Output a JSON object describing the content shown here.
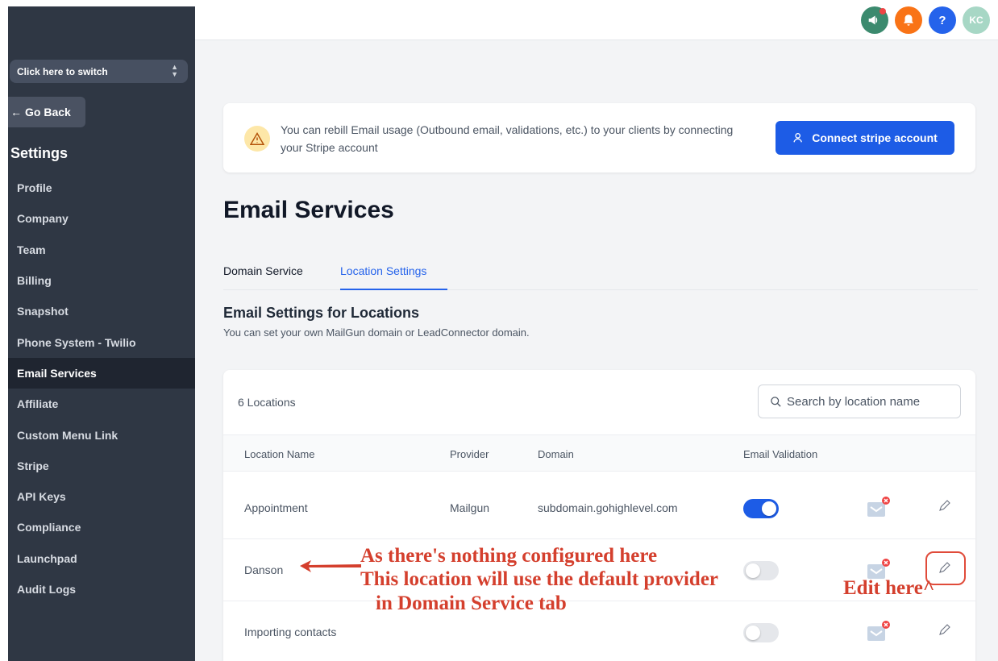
{
  "sidebar": {
    "switcher_label": "Click here to switch",
    "go_back_label": "Go Back",
    "settings_title": "Settings",
    "items": [
      {
        "label": "Profile",
        "active": false
      },
      {
        "label": "Company",
        "active": false
      },
      {
        "label": "Team",
        "active": false
      },
      {
        "label": "Billing",
        "active": false
      },
      {
        "label": "Snapshot",
        "active": false
      },
      {
        "label": "Phone System - Twilio",
        "active": false
      },
      {
        "label": "Email Services",
        "active": true
      },
      {
        "label": "Affiliate",
        "active": false
      },
      {
        "label": "Custom Menu Link",
        "active": false
      },
      {
        "label": "Stripe",
        "active": false
      },
      {
        "label": "API Keys",
        "active": false
      },
      {
        "label": "Compliance",
        "active": false
      },
      {
        "label": "Launchpad",
        "active": false
      },
      {
        "label": "Audit Logs",
        "active": false
      }
    ]
  },
  "header": {
    "icons": [
      "megaphone-icon",
      "bell-icon",
      "help-icon"
    ],
    "help_glyph": "?",
    "avatar_initials": "KC"
  },
  "banner": {
    "text": "You can rebill Email usage (Outbound email, validations, etc.) to your clients by connecting your Stripe account",
    "button_label": "Connect stripe account"
  },
  "page": {
    "title": "Email Services",
    "tabs": [
      {
        "label": "Domain Service",
        "active": false
      },
      {
        "label": "Location Settings",
        "active": true
      }
    ],
    "section_title": "Email Settings for Locations",
    "section_subtitle": "You can set your own MailGun domain or LeadConnector domain."
  },
  "table": {
    "count_label": "6 Locations",
    "search_placeholder": "Search by location name",
    "columns": [
      "Location Name",
      "Provider",
      "Domain",
      "Email Validation"
    ],
    "rows": [
      {
        "name": "Appointment",
        "provider": "Mailgun",
        "domain": "subdomain.gohighlevel.com",
        "validation": true
      },
      {
        "name": "Danson",
        "provider": "",
        "domain": "",
        "validation": false
      },
      {
        "name": "Importing contacts",
        "provider": "",
        "domain": "",
        "validation": false
      }
    ]
  },
  "annotations": {
    "line1": "As there's nothing configured here",
    "line2": "This location will use the default provider",
    "line3": "in Domain Service tab",
    "edit_here": "Edit here^"
  },
  "colors": {
    "sidebar_bg": "#2f3744",
    "accent": "#1d5ce6",
    "annotation": "#d43f2d"
  }
}
